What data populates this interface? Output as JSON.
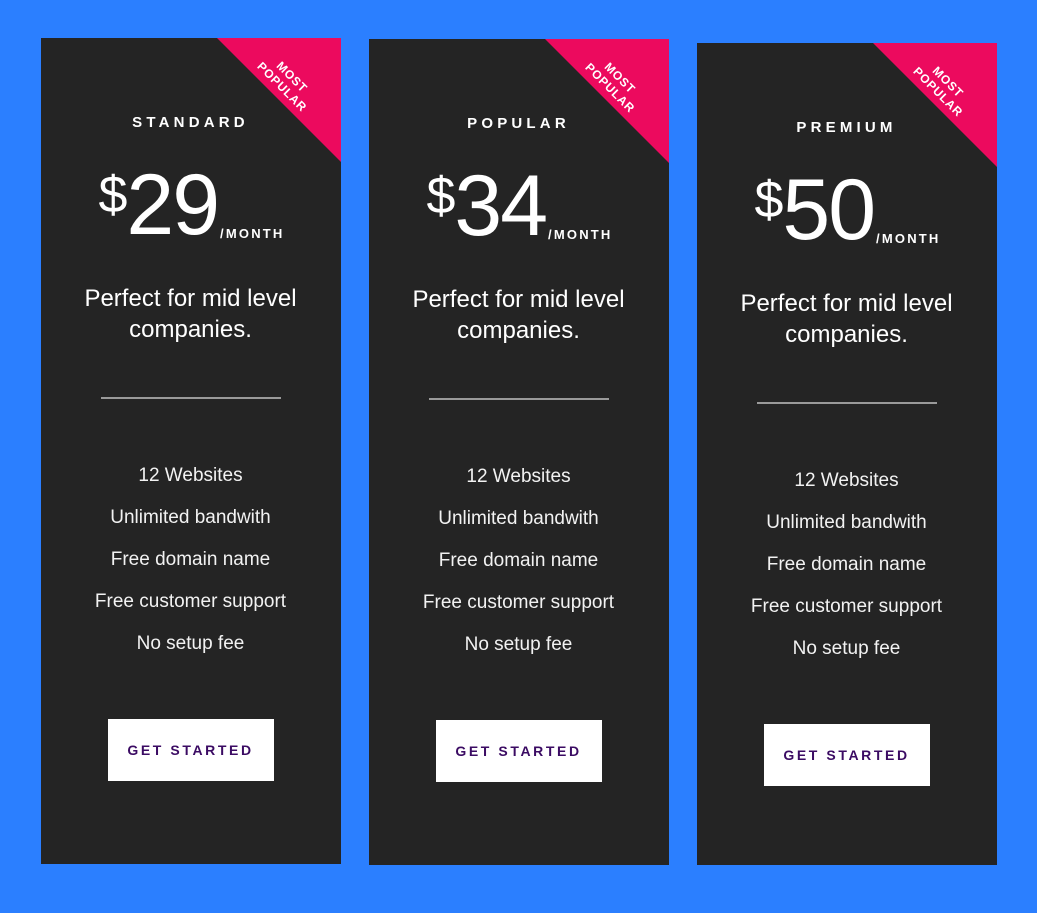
{
  "theme": {
    "page_background": "#2b7fff",
    "card_background": "#242424",
    "ribbon_color": "#ec0a5e",
    "button_background": "#ffffff",
    "button_text_color": "#3b0b63",
    "divider_color": "#9a9a9a",
    "text_color": "#ffffff"
  },
  "ribbon": {
    "label": "MOST\nPOPULAR"
  },
  "plans": [
    {
      "id": "standard",
      "title": "STANDARD",
      "currency": "$",
      "amount": "29",
      "period": "/MONTH",
      "tagline": "Perfect for mid level companies.",
      "features": [
        "12 Websites",
        "Unlimited bandwith",
        "Free domain name",
        "Free customer support",
        "No setup fee"
      ],
      "cta_label": "GET STARTED",
      "ribbon_label": "MOST\nPOPULAR"
    },
    {
      "id": "popular",
      "title": "POPULAR",
      "currency": "$",
      "amount": "34",
      "period": "/MONTH",
      "tagline": "Perfect for mid level companies.",
      "features": [
        "12 Websites",
        "Unlimited bandwith",
        "Free domain name",
        "Free customer support",
        "No setup fee"
      ],
      "cta_label": "GET STARTED",
      "ribbon_label": "MOST\nPOPULAR"
    },
    {
      "id": "premium",
      "title": "PREMIUM",
      "currency": "$",
      "amount": "50",
      "period": "/MONTH",
      "tagline": "Perfect for mid level companies.",
      "features": [
        "12 Websites",
        "Unlimited bandwith",
        "Free domain name",
        "Free customer support",
        "No setup fee"
      ],
      "cta_label": "GET STARTED",
      "ribbon_label": "MOST\nPOPULAR"
    }
  ]
}
